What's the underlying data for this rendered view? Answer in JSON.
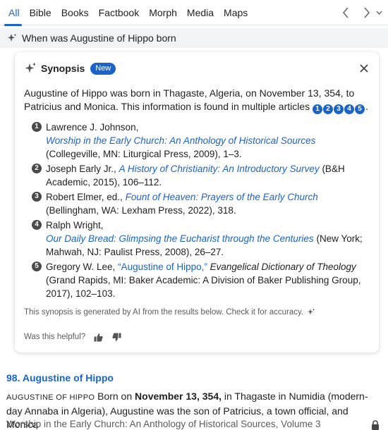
{
  "tabs": [
    {
      "label": "All",
      "active": true
    },
    {
      "label": "Bible",
      "active": false
    },
    {
      "label": "Books",
      "active": false
    },
    {
      "label": "Factbook",
      "active": false
    },
    {
      "label": "Morph",
      "active": false
    },
    {
      "label": "Media",
      "active": false
    },
    {
      "label": "Maps",
      "active": false
    }
  ],
  "nav": {
    "back_icon": "chevron-left-icon",
    "forward_icon": "chevron-right-icon",
    "menu_icon": "chevron-down-icon"
  },
  "query": {
    "text": "When was Augustine of Hippo born",
    "icon": "sparkle-icon"
  },
  "synopsis": {
    "title": "Synopsis",
    "badge": "New",
    "summary": "Augustine of Hippo was born in Thagaste, Algeria, on November 13, 354, to Patricius and Monica. This information is found in multiple articles",
    "article_numbers": [
      "1",
      "2",
      "3",
      "4",
      "5"
    ],
    "references": [
      {
        "num": "1",
        "author": "Lawrence J. Johnson,",
        "title": "Worship in the Early Church: An Anthology of Historical Sources",
        "details": "(Collegeville, MN: Liturgical Press, 2009), 1–3."
      },
      {
        "num": "2",
        "author": "Joseph Early Jr.,",
        "title": "A History of Christianity: An Introductory Survey",
        "details": "(B&H Academic, 2015), 106–112."
      },
      {
        "num": "3",
        "author": "Robert Elmer, ed.,",
        "title": "Fount of Heaven: Prayers of the Early Church",
        "details": "(Bellingham, WA: Lexham Press, 2022), 318."
      },
      {
        "num": "4",
        "author": "Ralph Wright,",
        "title": "Our Daily Bread: Glimpsing the Eucharist through the Centuries",
        "details": "(New York; Mahwah, NJ: Paulist Press, 2008), 26–27."
      },
      {
        "num": "5",
        "author": "Gregory W. Lee,",
        "title": "“Augustine of Hippo,”",
        "work": "Evangelical Dictionary of Theology",
        "details": "(Grand Rapids, MI: Baker Academic: A Division of Baker Publishing Group, 2017), 102–103."
      }
    ],
    "disclaimer": "This synopsis is generated by AI from the results below. Check it for accuracy.",
    "helpful": "Was this helpful?"
  },
  "result": {
    "title": "98. Augustine of Hippo",
    "headword": "AUGUSTINE OF HIPPO",
    "text_a": "Born on",
    "date": "November 13, 354,",
    "text_b": "in Thagaste in Numidia (modern-day Annaba in Algeria), Augustine was the son of Patricius, a town official, and Monica",
    "source": "Worship in the Early Church: An Anthology of Historical Sources, Volume 3"
  },
  "colors": {
    "accent": "#1a63c9",
    "query_bg": "#f2f3f5"
  }
}
